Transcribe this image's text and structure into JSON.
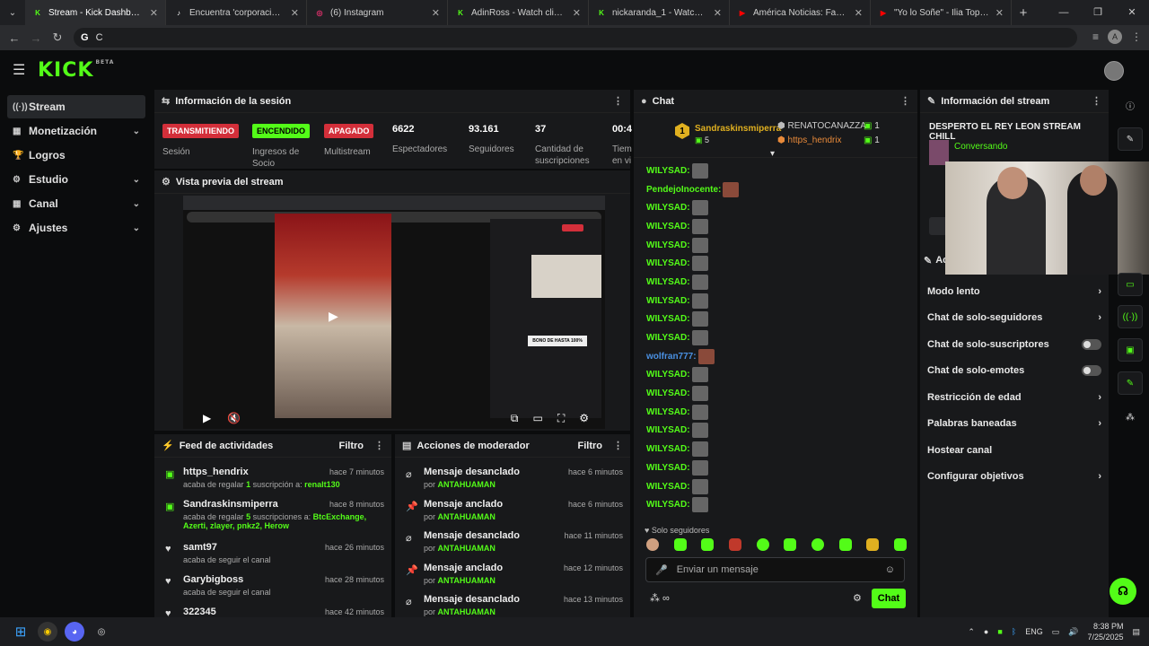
{
  "browser": {
    "tabs": [
      {
        "title": "Stream - Kick Dashboard",
        "fav": "K",
        "color": "#53fc18",
        "active": true
      },
      {
        "title": "Encuentra 'corporacion toto's' e",
        "fav": "♪",
        "color": "#ffffff"
      },
      {
        "title": "(6) Instagram",
        "fav": "◎",
        "color": "#e1306c"
      },
      {
        "title": "AdinRoss - Watch clips on Kick",
        "fav": "K",
        "color": "#53fc18"
      },
      {
        "title": "nickaranda_1 - Watch clips on K",
        "fav": "K",
        "color": "#53fc18"
      },
      {
        "title": "América Noticias: Familia denu",
        "fav": "▶",
        "color": "#ff0000"
      },
      {
        "title": "\"Yo lo Soñe\" - Ilia Topuria's Rid",
        "fav": "▶",
        "color": "#ff0000"
      }
    ],
    "new_tab": "+",
    "address": "C",
    "google_g": "G",
    "profile": "A"
  },
  "kick": {
    "logo": "KICK",
    "beta": "BETA"
  },
  "sidebar": {
    "items": [
      {
        "label": "Stream",
        "icon": "((·))",
        "active": true,
        "chev": ""
      },
      {
        "label": "Monetización",
        "icon": "▦",
        "chev": "⌄"
      },
      {
        "label": "Logros",
        "icon": "🏆",
        "chev": ""
      },
      {
        "label": "Estudio",
        "icon": "⚙",
        "chev": "⌄"
      },
      {
        "label": "Canal",
        "icon": "▦",
        "chev": "⌄"
      },
      {
        "label": "Ajustes",
        "icon": "⚙",
        "chev": "⌄"
      }
    ]
  },
  "session": {
    "title": "Información de la sesión",
    "stats": [
      {
        "badge": "TRANSMITIENDO",
        "label": "Sesión",
        "kind": "red"
      },
      {
        "badge": "ENCENDIDO",
        "label": "Ingresos de Socio",
        "kind": "green"
      },
      {
        "badge": "APAGADO",
        "label": "Multistream",
        "kind": "red"
      },
      {
        "num": "6622",
        "label": "Espectadores"
      },
      {
        "num": "93.161",
        "label": "Seguidores"
      },
      {
        "num": "37",
        "label": "Cantidad de suscripciones"
      },
      {
        "num": "00:4",
        "label": "Tiem en vi"
      }
    ]
  },
  "preview": {
    "title": "Vista previa del stream",
    "inner_label": "BONO DE HASTA 100%"
  },
  "feed": {
    "title": "Feed de actividades",
    "filter": "Filtro",
    "items": [
      {
        "name": "https_hendrix",
        "time": "hace 7 minutos",
        "icon": "gift",
        "text1": "acaba de regalar",
        "num": "1",
        "text2": "suscripción a:",
        "target": "renalt130"
      },
      {
        "name": "Sandraskinsmiperra",
        "time": "hace 8 minutos",
        "icon": "gift",
        "text1": "acaba de regalar",
        "num": "5",
        "text2": "suscripciones a:",
        "target": "BtcExchange, Azerti, zlayer, pnkz2, Herow"
      },
      {
        "name": "samt97",
        "time": "hace 26 minutos",
        "icon": "heart",
        "text1": "acaba de seguir el canal"
      },
      {
        "name": "Garybigboss",
        "time": "hace 28 minutos",
        "icon": "heart",
        "text1": "acaba de seguir el canal"
      },
      {
        "name": "322345",
        "time": "hace 42 minutos",
        "icon": "heart",
        "text1": ""
      }
    ]
  },
  "mod": {
    "title": "Acciones de moderador",
    "filter": "Filtro",
    "items": [
      {
        "action": "Mensaje desanclado",
        "time": "hace 6 minutos",
        "by": "por",
        "who": "ANTAHUAMAN",
        "icon": "unpin"
      },
      {
        "action": "Mensaje anclado",
        "time": "hace 6 minutos",
        "by": "por",
        "who": "ANTAHUAMAN",
        "icon": "pin"
      },
      {
        "action": "Mensaje desanclado",
        "time": "hace 11 minutos",
        "by": "por",
        "who": "ANTAHUAMAN",
        "icon": "unpin"
      },
      {
        "action": "Mensaje anclado",
        "time": "hace 12 minutos",
        "by": "por",
        "who": "ANTAHUAMAN",
        "icon": "pin"
      },
      {
        "action": "Mensaje desanclado",
        "time": "hace 13 minutos",
        "by": "por",
        "who": "ANTAHUAMAN",
        "icon": "unpin"
      }
    ]
  },
  "chat": {
    "title": "Chat",
    "top_gifters": [
      {
        "rank": "1",
        "name": "Sandraskinsmiperra",
        "count": "5"
      },
      {
        "rank": "",
        "name": "RENATOCANAZZA",
        "count": "1"
      },
      {
        "rank": "",
        "name": "https_hendrix",
        "count": "1"
      }
    ],
    "messages": [
      {
        "user": "WILYSAD:",
        "color": "green"
      },
      {
        "user": "PendejoInocente:",
        "color": "green",
        "red": true
      },
      {
        "user": "WILYSAD:",
        "color": "green"
      },
      {
        "user": "WILYSAD:",
        "color": "green"
      },
      {
        "user": "WILYSAD:",
        "color": "green"
      },
      {
        "user": "WILYSAD:",
        "color": "green"
      },
      {
        "user": "WILYSAD:",
        "color": "green"
      },
      {
        "user": "WILYSAD:",
        "color": "green"
      },
      {
        "user": "WILYSAD:",
        "color": "green"
      },
      {
        "user": "WILYSAD:",
        "color": "green"
      },
      {
        "user": "wolfran777:",
        "color": "blue",
        "red": true
      },
      {
        "user": "WILYSAD:",
        "color": "green"
      },
      {
        "user": "WILYSAD:",
        "color": "green"
      },
      {
        "user": "WILYSAD:",
        "color": "green"
      },
      {
        "user": "WILYSAD:",
        "color": "green"
      },
      {
        "user": "WILYSAD:",
        "color": "green"
      },
      {
        "user": "WILYSAD:",
        "color": "green"
      },
      {
        "user": "WILYSAD:",
        "color": "green"
      },
      {
        "user": "WILYSAD:",
        "color": "green"
      }
    ],
    "mode": "Solo seguidores",
    "placeholder": "Enviar un mensaje",
    "send": "Chat"
  },
  "stream_info": {
    "title": "Información del stream",
    "stream_title": "DESPERTO EL REY LEON STREAM CHILL",
    "category": "Conversando",
    "settings_title": "Ac",
    "settings": [
      {
        "label": "Modo lento",
        "type": "chev"
      },
      {
        "label": "Chat de solo-seguidores",
        "type": "chev"
      },
      {
        "label": "Chat de solo-suscriptores",
        "type": "toggle"
      },
      {
        "label": "Chat de solo-emotes",
        "type": "toggle"
      },
      {
        "label": "Restricción de edad",
        "type": "chev"
      },
      {
        "label": "Palabras baneadas",
        "type": "chev"
      },
      {
        "label": "Hostear canal",
        "type": "none"
      },
      {
        "label": "Configurar objetivos",
        "type": "chev"
      }
    ]
  },
  "taskbar": {
    "lang": "ENG",
    "time": "8:38 PM",
    "date": "7/25/2025"
  },
  "colors": {
    "accent": "#53fc18",
    "red": "#d32f3a",
    "blue": "#4a90e2"
  }
}
